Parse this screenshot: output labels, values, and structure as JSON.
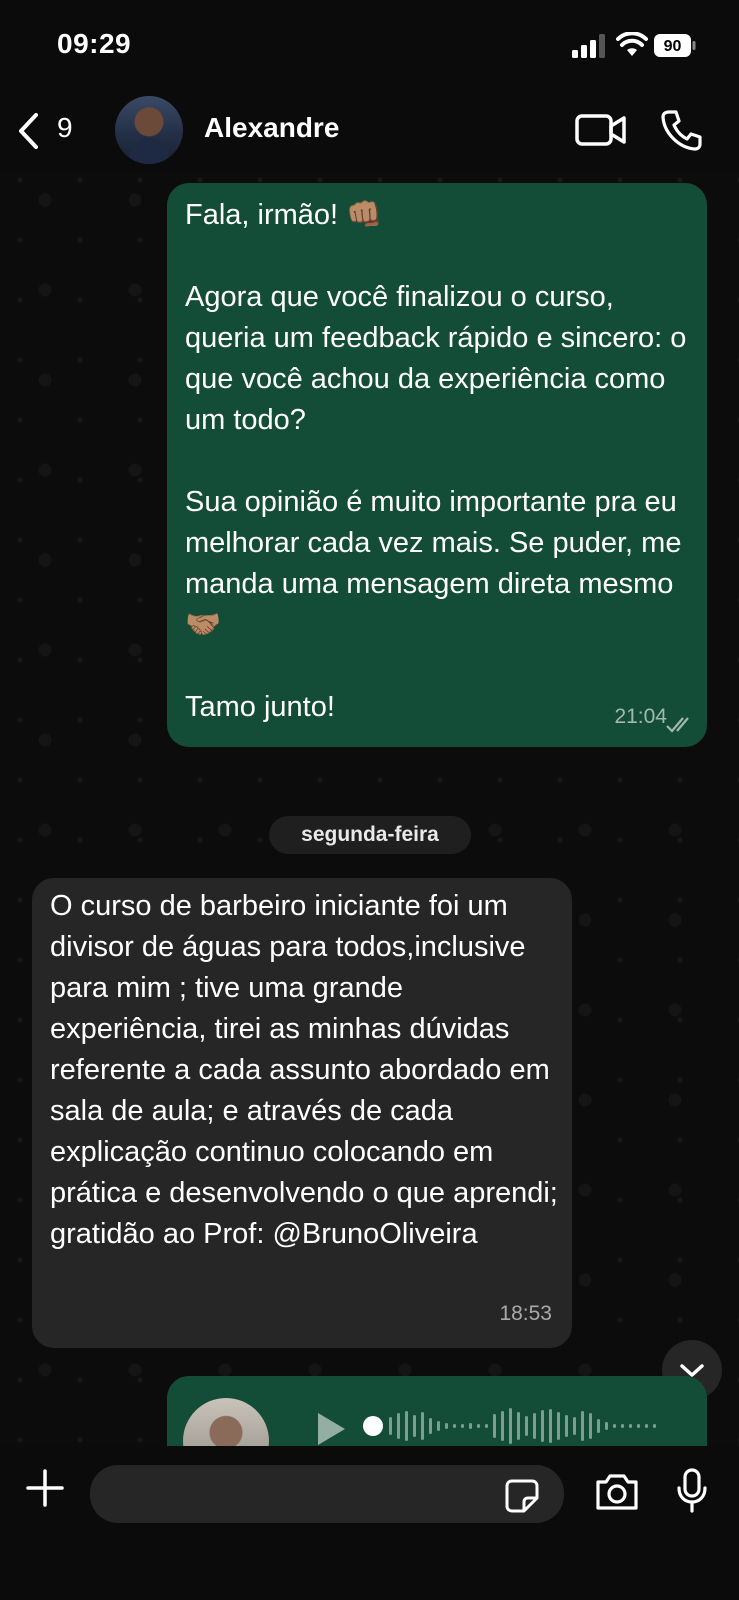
{
  "status_bar": {
    "time": "09:29",
    "battery": "90"
  },
  "header": {
    "back_count": "9",
    "contact_name": "Alexandre"
  },
  "messages": [
    {
      "direction": "outgoing",
      "text": "Fala, irmão! 👊🏽\n\nAgora que você finalizou o curso, queria um feedback rápido e sincero: o que você achou da experiência como um todo?\n\nSua opinião é muito importante pra eu melhorar cada vez mais. Se puder, me manda uma mensagem direta mesmo 🤝🏽\n\nTamo junto!",
      "time": "21:04",
      "status": "read"
    },
    {
      "direction": "incoming",
      "text": "O curso de barbeiro iniciante foi um divisor de águas para todos,inclusive para mim ; tive uma grande experiência, tirei as minhas dúvidas referente a cada assunto abordado em sala de aula; e através de cada explicação continuo colocando em prática e desenvolvendo o que aprendi; gratidão ao Prof: @BrunoOliveira",
      "time": "18:53"
    },
    {
      "direction": "outgoing",
      "type": "audio"
    }
  ],
  "date_separator": "segunda-feira",
  "composer": {
    "placeholder": ""
  },
  "icons": [
    "back-chevron-icon",
    "video-call-icon",
    "phone-icon",
    "checkmarks-icon",
    "chevron-down-icon",
    "play-icon",
    "plus-icon",
    "sticker-icon",
    "camera-icon",
    "microphone-icon"
  ],
  "colors": {
    "outgoing_bubble": "#144d37",
    "incoming_bubble": "#262626",
    "background": "#0b0b0b"
  }
}
